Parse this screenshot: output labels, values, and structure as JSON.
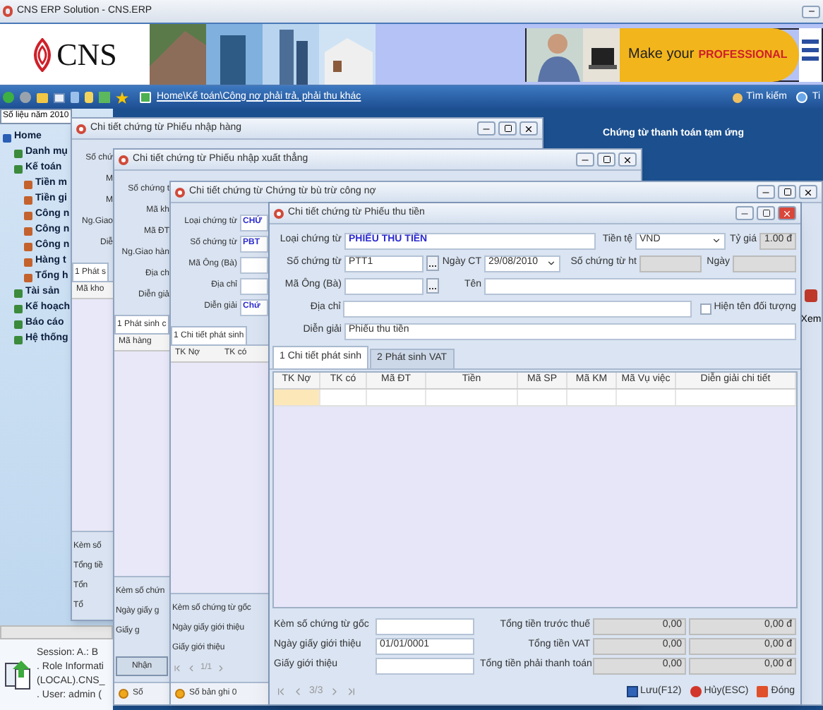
{
  "window": {
    "title": "CNS ERP Solution - CNS.ERP"
  },
  "banner": {
    "logo": "CNS",
    "ad_text": "Make your",
    "ad_highlight": "PROFESSIONAL"
  },
  "toolbar": {
    "breadcrumb": "Home\\Kế toán\\Công nợ phải trả, phải thu khác",
    "search": "Tìm kiếm",
    "next_item": "Ti"
  },
  "sidebar": {
    "tab": "Số liệu năm 2010",
    "items": [
      {
        "label": "Home",
        "children": [
          {
            "label": "Danh mụ"
          },
          {
            "label": "Kế toán",
            "children": [
              {
                "label": "Tiền m"
              },
              {
                "label": "Tiền gi"
              },
              {
                "label": "Công n"
              },
              {
                "label": "Công n"
              },
              {
                "label": "Công n"
              },
              {
                "label": "Hàng t"
              },
              {
                "label": "Tổng h"
              }
            ]
          },
          {
            "label": "Tài sản"
          },
          {
            "label": "Kế hoạch"
          },
          {
            "label": "Báo cáo"
          },
          {
            "label": "Hệ thống"
          }
        ]
      }
    ]
  },
  "session": [
    "Session: A.: B",
    ". Role Informati",
    "(LOCAL).CNS_",
    ". User: admin ("
  ],
  "desktop_header": "Chứng từ thanh toán tạm ứng",
  "back_windows": [
    {
      "title": "Chi tiết chứng từ Phiếu nhập hàng",
      "fields": [
        {
          "label": "Số chứ"
        },
        {
          "label": "M"
        },
        {
          "label": "M"
        },
        {
          "label": "Ng.Giao"
        },
        {
          "label": "Diễ"
        }
      ],
      "tabs": [
        {
          "label": "1 Phát s",
          "selected": true
        }
      ],
      "columns": [
        "Mã kho"
      ],
      "footer": [
        "Kèm số",
        "Tổng tiề",
        "Tổn",
        "Tổ"
      ]
    },
    {
      "title": "Chi tiết chứng từ Phiếu nhập xuất thẳng",
      "fields": [
        {
          "label": "Số chứng t"
        },
        {
          "label": "Mã kh"
        },
        {
          "label": "Mã ĐT"
        },
        {
          "label": "Ng.Giao hàn"
        },
        {
          "label": "Địa ch"
        },
        {
          "label": "Diễn giả"
        }
      ],
      "tabs": [
        {
          "label": "1 Phát sinh c",
          "selected": true
        }
      ],
      "columns": [
        "Mã hàng"
      ],
      "footer": [
        "Kèm số chứn",
        "Ngày giấy g",
        "Giấy g"
      ],
      "button": "Nhận",
      "status": "Số"
    },
    {
      "title": "Chi tiết chứng từ Chứng từ bù trừ công nợ",
      "fields": [
        {
          "label": "Loại chứng từ",
          "value": "CHỨ"
        },
        {
          "label": "Số chứng từ",
          "value": "PBT"
        },
        {
          "label": "Mã Ông (Bà)"
        },
        {
          "label": "Địa chỉ"
        },
        {
          "label": "Diễn giải",
          "value": "Chứ"
        }
      ],
      "tabs": [
        {
          "label": "1 Chi tiết phát sinh",
          "selected": true
        }
      ],
      "columns": [
        "TK Nợ",
        "TK có"
      ],
      "footer": [
        "Kèm số chứng từ gốc",
        "Ngày giấy giới thiệu",
        "Giấy giới thiệu"
      ],
      "pager": "1/1",
      "status": "Số bản ghi 0",
      "side_button": "Xem"
    }
  ],
  "voucher": {
    "title": "Chi tiết chứng từ Phiếu thu tiền",
    "type": {
      "label": "Loại chứng từ",
      "value": "PHIẾU THU TIỀN"
    },
    "currency": {
      "label": "Tiền tệ",
      "value": "VND"
    },
    "rate": {
      "label": "Tỷ giá",
      "value": "1.00 đ"
    },
    "number": {
      "label": "Số chứng từ",
      "value": "PTT1"
    },
    "date": {
      "label": "Ngày CT",
      "value": "29/08/2010"
    },
    "ref_number": {
      "label": "Số chứng từ ht"
    },
    "ref_date": {
      "label": "Ngày"
    },
    "customer": {
      "label": "Mã Ông (Bà)"
    },
    "name": {
      "label": "Tên"
    },
    "address": {
      "label": "Địa chỉ"
    },
    "show_name": {
      "label": "Hiện tên đối tượng",
      "checked": false
    },
    "description": {
      "label": "Diễn giải",
      "value": "Phiếu thu tiền"
    },
    "tabs": [
      {
        "label": "1 Chi tiết phát sinh",
        "selected": true
      },
      {
        "label": "2 Phát sinh VAT",
        "selected": false
      }
    ],
    "columns": [
      "TK Nợ",
      "TK có",
      "Mã ĐT",
      "Tiền",
      "Mã SP",
      "Mã KM",
      "Mã Vụ việc",
      "Diễn giải chi tiết"
    ],
    "attachments": [
      {
        "label": "Kèm số chứng từ gốc"
      },
      {
        "label": "Ngày giấy giới thiệu",
        "value": "01/01/0001"
      },
      {
        "label": "Giấy giới thiệu"
      }
    ],
    "totals": [
      {
        "label": "Tổng tiền trước thuế",
        "amount": "0,00",
        "amount_vnd": "0,00 đ"
      },
      {
        "label": "Tổng tiền VAT",
        "amount": "0,00",
        "amount_vnd": "0,00 đ"
      },
      {
        "label": "Tổng tiền phải thanh toán",
        "amount": "0,00",
        "amount_vnd": "0,00 đ"
      }
    ],
    "pager": "3/3",
    "buttons": [
      {
        "label": "Lưu(F12)",
        "kind": "save"
      },
      {
        "label": "Hủy(ESC)",
        "kind": "cancel"
      },
      {
        "label": "Đóng",
        "kind": "close"
      }
    ]
  }
}
